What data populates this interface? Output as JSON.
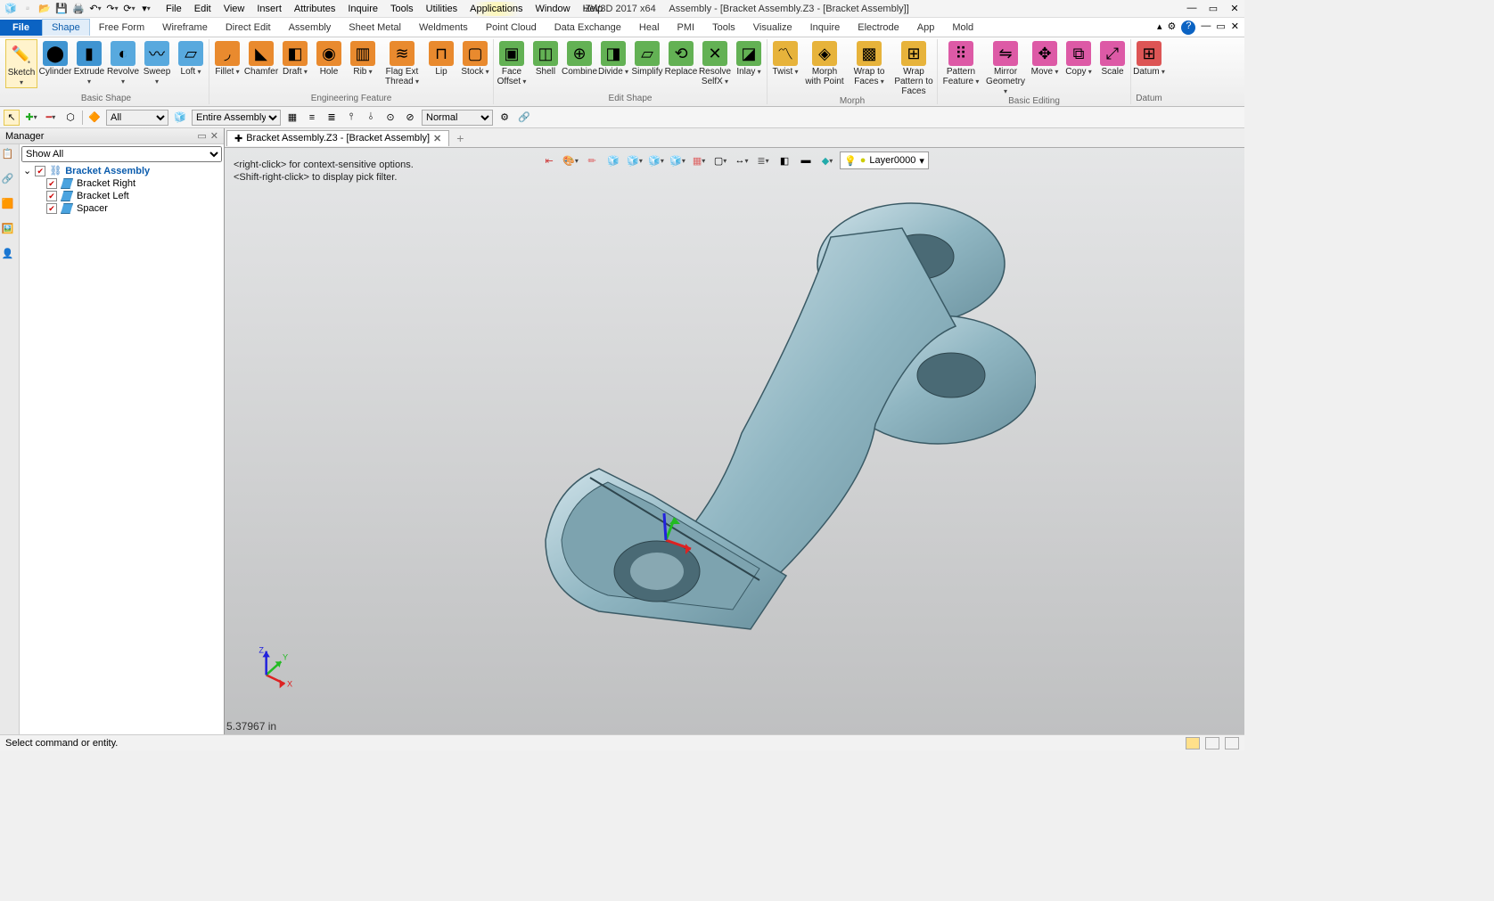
{
  "app_title_left": "ZW3D 2017  x64",
  "app_title_doc": "Assembly - [Bracket Assembly.Z3 - [Bracket Assembly]]",
  "menu": [
    "File",
    "Edit",
    "View",
    "Insert",
    "Attributes",
    "Inquire",
    "Tools",
    "Utilities",
    "Applications",
    "Window",
    "Help"
  ],
  "ribbon_tabs": [
    "File",
    "Shape",
    "Free Form",
    "Wireframe",
    "Direct Edit",
    "Assembly",
    "Sheet Metal",
    "Weldments",
    "Point Cloud",
    "Data Exchange",
    "Heal",
    "PMI",
    "Tools",
    "Visualize",
    "Inquire",
    "Electrode",
    "App",
    "Mold"
  ],
  "ribbon": {
    "basic_shape": {
      "label": "Basic Shape",
      "items": [
        "Sketch",
        "Cylinder",
        "Extrude",
        "Revolve",
        "Sweep",
        "Loft"
      ]
    },
    "eng_feature": {
      "label": "Engineering Feature",
      "items": [
        "Fillet",
        "Chamfer",
        "Draft",
        "Hole",
        "Rib",
        "Flag Ext Thread",
        "Lip",
        "Stock"
      ]
    },
    "edit_shape": {
      "label": "Edit Shape",
      "items": [
        "Face Offset",
        "Shell",
        "Combine",
        "Divide",
        "Simplify",
        "Replace",
        "Resolve SelfX",
        "Inlay"
      ]
    },
    "morph": {
      "label": "Morph",
      "items": [
        "Twist",
        "Morph with Point",
        "Wrap to Faces",
        "Wrap Pattern to Faces"
      ]
    },
    "basic_edit": {
      "label": "Basic Editing",
      "items": [
        "Pattern Feature",
        "Mirror Geometry",
        "Move",
        "Copy",
        "Scale"
      ]
    },
    "datum": {
      "label": "Datum",
      "items": [
        "Datum"
      ]
    }
  },
  "filter": {
    "mode": "All",
    "scope": "Entire Assembly",
    "display": "Normal"
  },
  "manager": {
    "title": "Manager",
    "filter": "Show All"
  },
  "tree": {
    "root": "Bracket Assembly",
    "children": [
      "Bracket Right",
      "Bracket Left",
      "Spacer"
    ]
  },
  "tab": {
    "name": "Bracket Assembly.Z3 - [Bracket Assembly]"
  },
  "hints": {
    "line1": "<right-click> for context-sensitive options.",
    "line2": "<Shift-right-click> to display pick filter."
  },
  "layer": "Layer0000",
  "readout": "5.37967 in",
  "status": "Select command or entity.",
  "triad": {
    "x": "X",
    "y": "Y",
    "z": "Z"
  }
}
